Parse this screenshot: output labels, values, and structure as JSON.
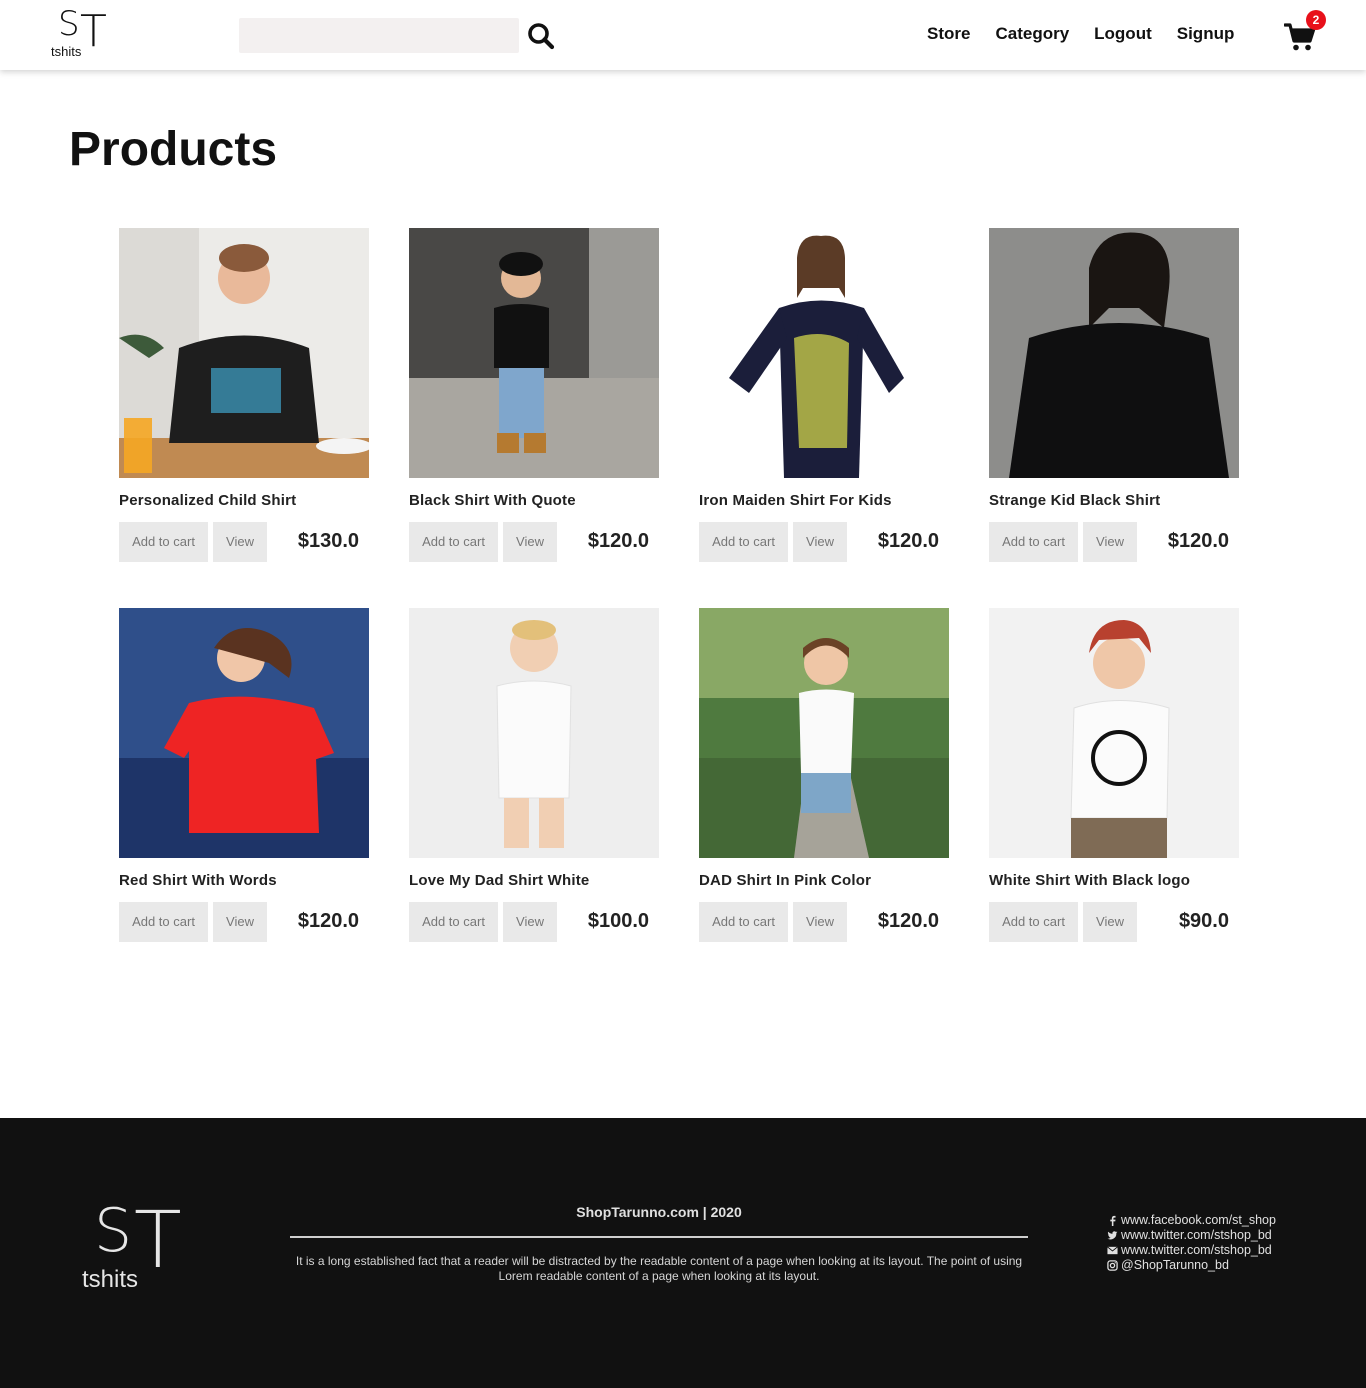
{
  "header": {
    "logo_text": "ST",
    "logo_tag": "tshits",
    "search_placeholder": "",
    "nav": [
      "Store",
      "Category",
      "Logout",
      "Signup"
    ],
    "cart_count": "2"
  },
  "main": {
    "title": "Products",
    "products": [
      {
        "name": "Personalized Child Shirt",
        "price": "$130.0",
        "add": "Add to cart",
        "view": "View"
      },
      {
        "name": "Black Shirt With Quote",
        "price": "$120.0",
        "add": "Add to cart",
        "view": "View"
      },
      {
        "name": "Iron Maiden Shirt For Kids",
        "price": "$120.0",
        "add": "Add to cart",
        "view": "View"
      },
      {
        "name": "Strange Kid Black Shirt",
        "price": "$120.0",
        "add": "Add to cart",
        "view": "View"
      },
      {
        "name": "Red Shirt With Words",
        "price": "$120.0",
        "add": "Add to cart",
        "view": "View"
      },
      {
        "name": "Love My Dad Shirt White",
        "price": "$100.0",
        "add": "Add to cart",
        "view": "View"
      },
      {
        "name": "DAD Shirt In Pink Color",
        "price": "$120.0",
        "add": "Add to cart",
        "view": "View"
      },
      {
        "name": "White Shirt With Black logo",
        "price": "$90.0",
        "add": "Add to cart",
        "view": "View"
      }
    ]
  },
  "footer": {
    "logo_text": "ST",
    "logo_tag": "tshits",
    "copyright": "ShopTarunno.com | 2020",
    "text": "It is a long established fact that a reader will be distracted by the readable content of a page when looking at its layout. The point of using Lorem readable content of a page when looking at its layout.",
    "links": [
      {
        "icon": "facebook-icon",
        "label": "www.facebook.com/st_shop"
      },
      {
        "icon": "twitter-icon",
        "label": "www.twitter.com/stshop_bd"
      },
      {
        "icon": "email-icon",
        "label": "www.twitter.com/stshop_bd"
      },
      {
        "icon": "instagram-icon",
        "label": "@ShopTarunno_bd"
      }
    ]
  },
  "colors": {
    "badge": "#e8101a",
    "footer_bg": "#111111",
    "button_bg": "#e9e9e9",
    "search_bg": "#f3f0f0"
  }
}
